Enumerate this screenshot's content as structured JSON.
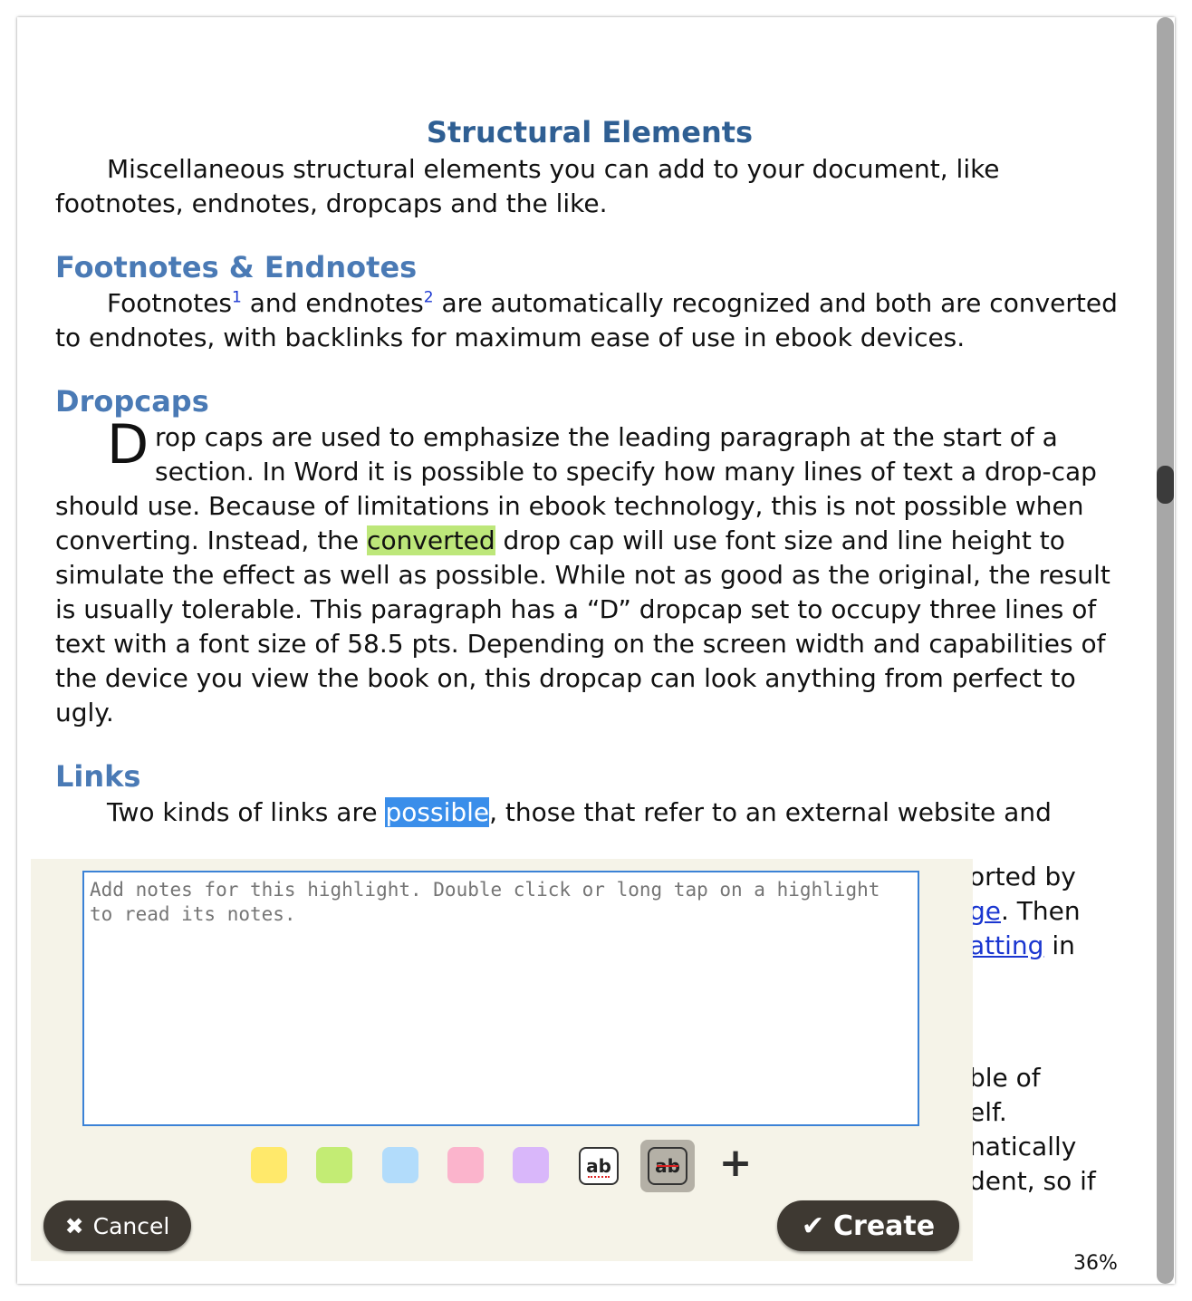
{
  "document": {
    "title": "Structural Elements",
    "intro": "Miscellaneous structural elements you can add to your document, like footnotes, endnotes, dropcaps and the like.",
    "footnotes": {
      "heading": "Footnotes & Endnotes",
      "text_a": "Footnotes",
      "sup1": "1",
      "text_b": " and endnotes",
      "sup2": "2",
      "text_c": " are automatically recognized and both are converted to endnotes, with backlinks for maximum ease of use in ebook devices."
    },
    "dropcaps": {
      "heading": "Dropcaps",
      "letter": "D",
      "line1": "rop caps are used to emphasize the leading paragraph at the start of a",
      "line2": "section. In Word it is possible to specify how many lines of text a drop-cap",
      "text_before": "should use. Because of limitations in ebook technology, this is not possible when converting.  Instead, the ",
      "highlight": "converted",
      "text_after": " drop cap will use font size and line height to simulate the effect as well as possible. While not as good as the original, the result is usually tolerable. This paragraph has a “D” dropcap set to occupy three lines of text with a font size of 58.5 pts. Depending on the screen width and capabilities of the device you view the book on, this dropcap can look anything from perfect to ugly."
    },
    "links": {
      "heading": "Links",
      "text_before": "Two kinds of links are ",
      "selected": "possible",
      "text_after": ", those that refer to an external website and"
    }
  },
  "behind_fragments": {
    "f1": "orted by",
    "f2_link": "ge",
    "f2_text": ". Then",
    "f3_link": "atting",
    "f3_text": " in",
    "f4": "ble of",
    "f5": "elf.",
    "f6": "natically",
    "f7": "dent, so if"
  },
  "highlight_panel": {
    "notes_placeholder": "Add notes for this highlight. Double click or long tap on a highlight to read its notes.",
    "colors": [
      "#ffe96b",
      "#c3ec74",
      "#b2dcfb",
      "#fbb4cc",
      "#d9b7fa"
    ],
    "squiggly_label": "ab",
    "strike_label": "ab",
    "plus_label": "+",
    "cancel_label": "Cancel",
    "create_label": "Create"
  },
  "progress": "36%"
}
